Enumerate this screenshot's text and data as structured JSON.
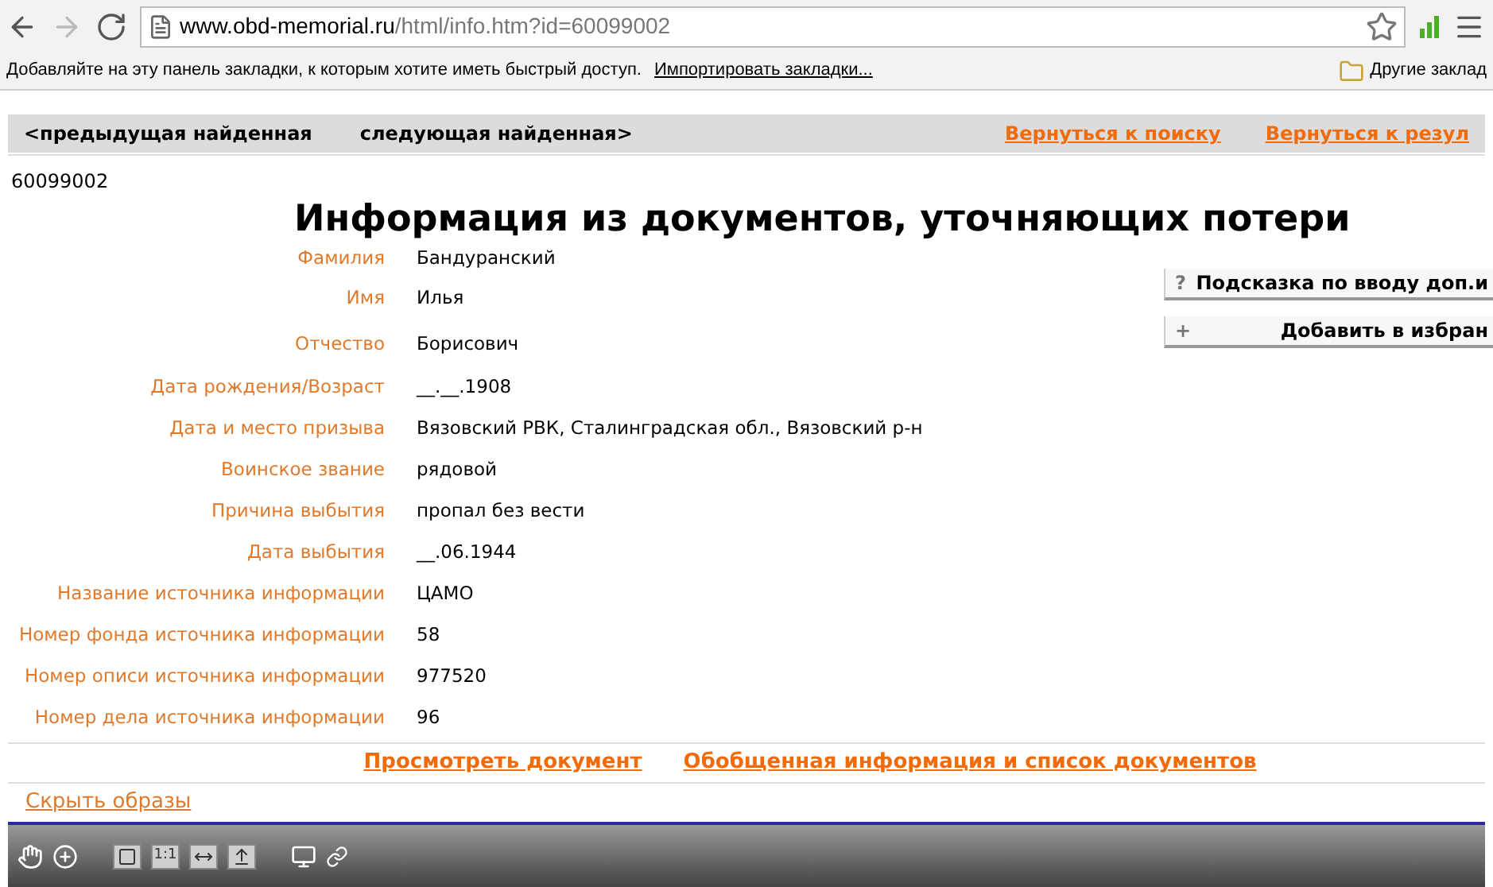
{
  "browser": {
    "url_host": "www.obd-memorial.ru",
    "url_path": "/html/info.htm?id=60099002",
    "bookmarks_hint": "Добавляйте на эту панель закладки, к которым хотите иметь быстрый доступ.",
    "import_link": "Импортировать закладки...",
    "other_bookmarks": "Другие заклад"
  },
  "nav": {
    "prev": "<предыдущая найденная",
    "next": "следующая найденная>",
    "links": [
      "Вернуться к поиску",
      "Вернуться к резул"
    ]
  },
  "record_id": "60099002",
  "title": "Информация из документов, уточняющих потери",
  "fields": [
    {
      "label": "Фамилия",
      "value": "Бандуранский"
    },
    {
      "label": "Имя",
      "value": "Илья"
    },
    {
      "label": "Отчество",
      "value": "Борисович"
    },
    {
      "label": "Дата рождения/Возраст",
      "value": "__.__.1908"
    },
    {
      "label": "Дата и место призыва",
      "value": "Вязовский РВК, Сталинградская обл., Вязовский р-н"
    },
    {
      "label": "Воинское звание",
      "value": "рядовой"
    },
    {
      "label": "Причина выбытия",
      "value": "пропал без вести"
    },
    {
      "label": "Дата выбытия",
      "value": "__.06.1944"
    },
    {
      "label": "Название источника информации",
      "value": "ЦАМО"
    },
    {
      "label": "Номер фонда источника информации",
      "value": "58"
    },
    {
      "label": "Номер описи источника информации",
      "value": "977520"
    },
    {
      "label": "Номер дела источника информации",
      "value": "96"
    }
  ],
  "side_buttons": [
    {
      "symbol": "?",
      "label": "Подсказка по вводу доп.и"
    },
    {
      "symbol": "+",
      "label": "Добавить в избран"
    }
  ],
  "footer_links": [
    "Просмотреть документ",
    "Обобщенная информация и список документов"
  ],
  "hide_images": "Скрыть образы",
  "viewer_toolbar": [
    {
      "kind": "hand"
    },
    {
      "kind": "zoom"
    },
    {
      "kind": "gap"
    },
    {
      "kind": "frame"
    },
    {
      "kind": "text",
      "label": "1:1"
    },
    {
      "kind": "width"
    },
    {
      "kind": "height"
    },
    {
      "kind": "gap"
    },
    {
      "kind": "monitor"
    },
    {
      "kind": "link"
    }
  ]
}
